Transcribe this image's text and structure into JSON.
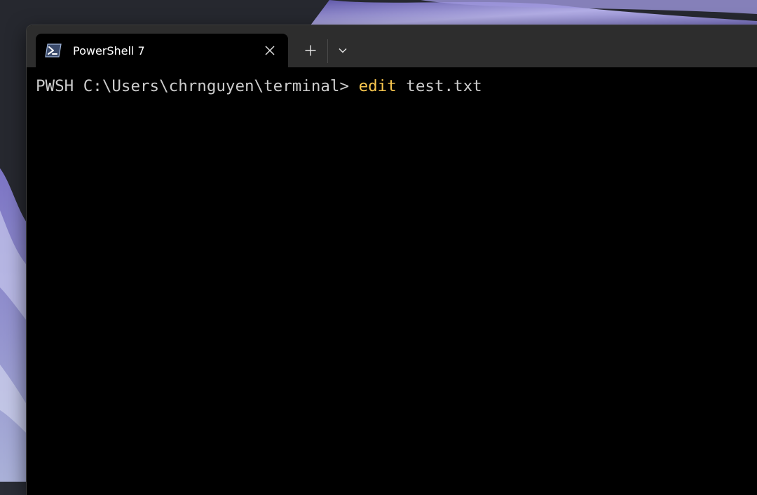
{
  "tab": {
    "title": "PowerShell 7",
    "icon": "powershell-icon"
  },
  "tabbar": {
    "close_icon": "close-icon",
    "new_tab_icon": "plus-icon",
    "dropdown_icon": "chevron-down-icon"
  },
  "terminal": {
    "prompt": "PWSH C:\\Users\\chrnguyen\\terminal> ",
    "command": "edit",
    "arguments": " test.txt"
  },
  "colors": {
    "terminal_background": "#000000",
    "tabbar_background": "#2d2d2d",
    "prompt_text": "#cccccc",
    "command_highlight": "#f9c74f",
    "wallpaper_accent": "#8b7fd4"
  }
}
